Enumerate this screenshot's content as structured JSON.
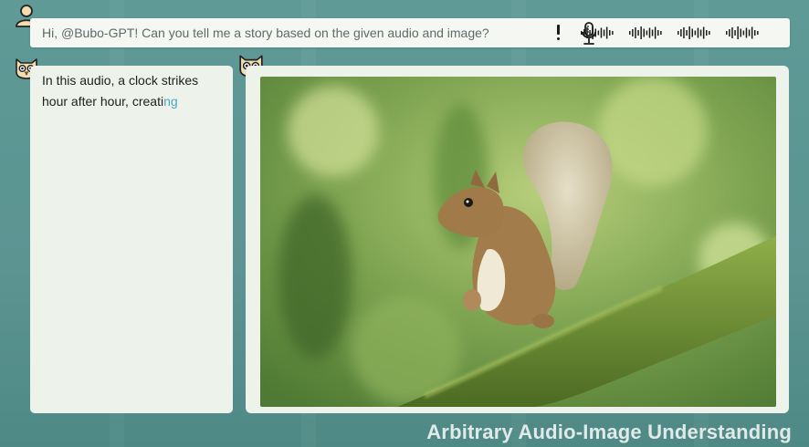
{
  "prompt": {
    "text": "Hi, @Bubo-GPT! Can you tell me a story based on the given audio and image?"
  },
  "response": {
    "line1": "In this audio, a clock strikes",
    "line2_main": "hour after hour, creati",
    "line2_fade": "ng"
  },
  "footer": {
    "title": "Arbitrary Audio-Image Understanding"
  },
  "icons": {
    "user": "user-avatar-icon",
    "bot": "owl-avatar-icon",
    "mic": "microphone-icon",
    "audio": "audio-waveform-icon"
  },
  "colors": {
    "background": "#5f9a97",
    "panel": "#edf2ea",
    "prompt_text": "#5d6b6a",
    "typing_accent": "#4aa8c5",
    "avatar_fill": "#f3ddb0"
  }
}
